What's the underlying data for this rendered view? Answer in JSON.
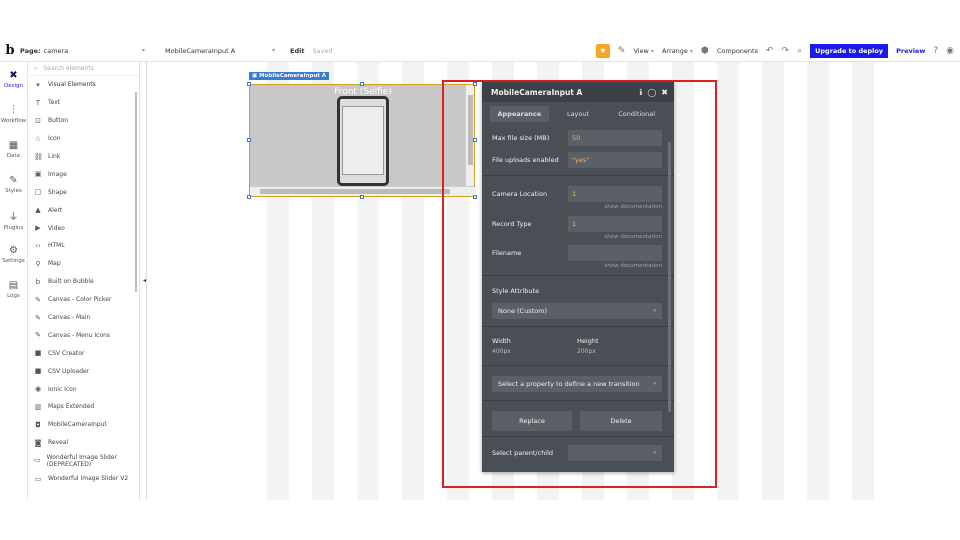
{
  "topbar": {
    "logo": "b",
    "page_label": "Page:",
    "page_value": "camera",
    "element_value": "MobileCameraInput A",
    "edit": "Edit",
    "saved": "Saved",
    "view": "View",
    "arrange": "Arrange",
    "components": "Components",
    "upgrade": "Upgrade to deploy",
    "preview": "Preview"
  },
  "rail": [
    {
      "label": "Design",
      "icon": "✖",
      "active": true
    },
    {
      "label": "Workflow",
      "icon": "⫶"
    },
    {
      "label": "Data",
      "icon": "▦"
    },
    {
      "label": "Styles",
      "icon": "✎"
    },
    {
      "label": "Plugins",
      "icon": "⏚"
    },
    {
      "label": "Settings",
      "icon": "⚙"
    },
    {
      "label": "Logs",
      "icon": "▤"
    }
  ],
  "palette": {
    "search_placeholder": "Search elements",
    "items": [
      {
        "label": "Visual Elements",
        "icon": "▾"
      },
      {
        "label": "Text",
        "icon": "T"
      },
      {
        "label": "Button",
        "icon": "⊡"
      },
      {
        "label": "Icon",
        "icon": "☆"
      },
      {
        "label": "Link",
        "icon": "⛓"
      },
      {
        "label": "Image",
        "icon": "▣"
      },
      {
        "label": "Shape",
        "icon": "□"
      },
      {
        "label": "Alert",
        "icon": "▲"
      },
      {
        "label": "Video",
        "icon": "▶"
      },
      {
        "label": "HTML",
        "icon": "‹›"
      },
      {
        "label": "Map",
        "icon": "⚲"
      },
      {
        "label": "Built on Bubble",
        "icon": "b"
      },
      {
        "label": "Canvas - Color Picker",
        "icon": "✎"
      },
      {
        "label": "Canvas - Main",
        "icon": "✎"
      },
      {
        "label": "Canvas - Menu Icons",
        "icon": "✎"
      },
      {
        "label": "CSV Creator",
        "icon": "■"
      },
      {
        "label": "CSV Uploader",
        "icon": "■"
      },
      {
        "label": "Ionic Icon",
        "icon": "◉"
      },
      {
        "label": "Maps Extended",
        "icon": "▥"
      },
      {
        "label": "MobileCameraInput",
        "icon": "◘"
      },
      {
        "label": "Reveal",
        "icon": "◙"
      },
      {
        "label": "Wonderful Image Slider (DEPRECATED)",
        "icon": "▭"
      },
      {
        "label": "Wonderful Image Slider V2",
        "icon": "▭"
      }
    ]
  },
  "canvas": {
    "element_tag": "MobileCameraInput A",
    "camera_text": "Front (Selfie)"
  },
  "property_editor": {
    "title": "MobileCameraInput A",
    "tabs": [
      "Appearance",
      "Layout",
      "Conditional"
    ],
    "max_file_size_label": "Max file size (MB)",
    "max_file_size_value": "50",
    "file_uploads_label": "File uploads enabled",
    "file_uploads_value": "\"yes\"",
    "camera_location_label": "Camera Location",
    "camera_location_value": "1",
    "record_type_label": "Record Type",
    "record_type_value": "1",
    "filename_label": "Filename",
    "filename_value": "",
    "show_doc": "show documentation",
    "style_attr_label": "Style Attribute",
    "style_value": "None (Custom)",
    "width_label": "Width",
    "width_value": "400px",
    "height_label": "Height",
    "height_value": "200px",
    "transition_placeholder": "Select a property to define a new transition",
    "replace_button": "Replace",
    "delete_button": "Delete",
    "select_parent_label": "Select parent/child"
  }
}
